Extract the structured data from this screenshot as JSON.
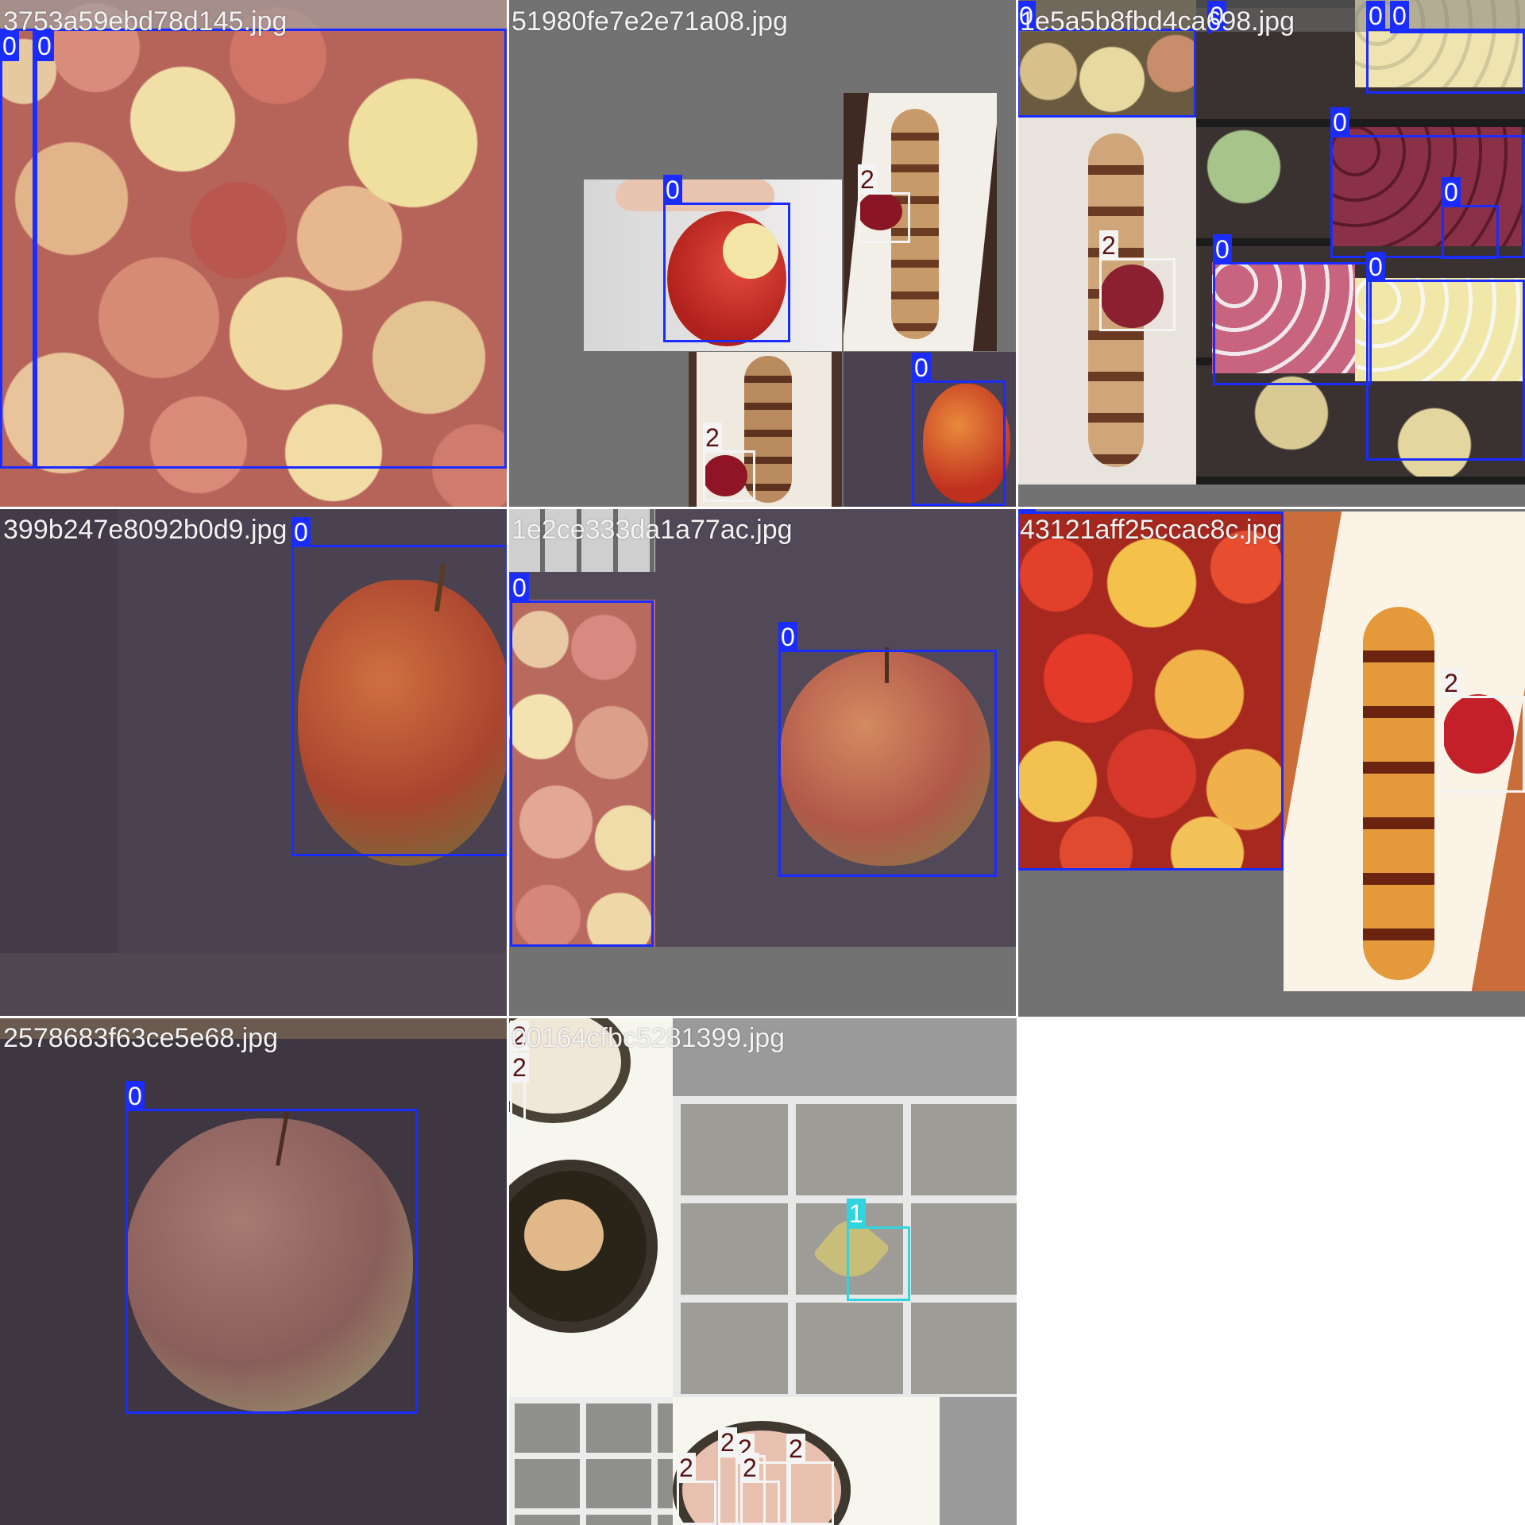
{
  "classes": {
    "apple": "0",
    "banana": "1",
    "strawberry_dessert": "2"
  },
  "colors": {
    "class_0": "#1a2cff",
    "class_1": "#2fd4e0",
    "class_2": "#f4f4f4",
    "mosaic_padding": "#727272"
  },
  "tiles": [
    {
      "filename": "3753a59ebd78d145.jpg",
      "labels": [
        "0",
        "0"
      ]
    },
    {
      "filename": "51980fe7e2e71a08.jpg",
      "labels": [
        "0",
        "2",
        "2",
        "0"
      ]
    },
    {
      "filename": "1e5a5b8fbd4ca698.jpg",
      "labels": [
        "0",
        "0",
        "0",
        "0",
        "0",
        "2",
        "0",
        "0",
        "0"
      ]
    },
    {
      "filename": "399b247e8092b0d9.jpg",
      "labels": [
        "0"
      ]
    },
    {
      "filename": "1e2ce333da1a77ac.jpg",
      "labels": [
        "0",
        "0"
      ]
    },
    {
      "filename": "43121aff25ccac8c.jpg",
      "labels": [
        "0",
        "2"
      ]
    },
    {
      "filename": "2578683f63ce5e68.jpg",
      "labels": [
        "0"
      ]
    },
    {
      "filename": "00164cfbc5281399.jpg",
      "labels": [
        "2",
        "2",
        "1",
        "2",
        "2",
        "2",
        "2",
        "2"
      ]
    }
  ]
}
